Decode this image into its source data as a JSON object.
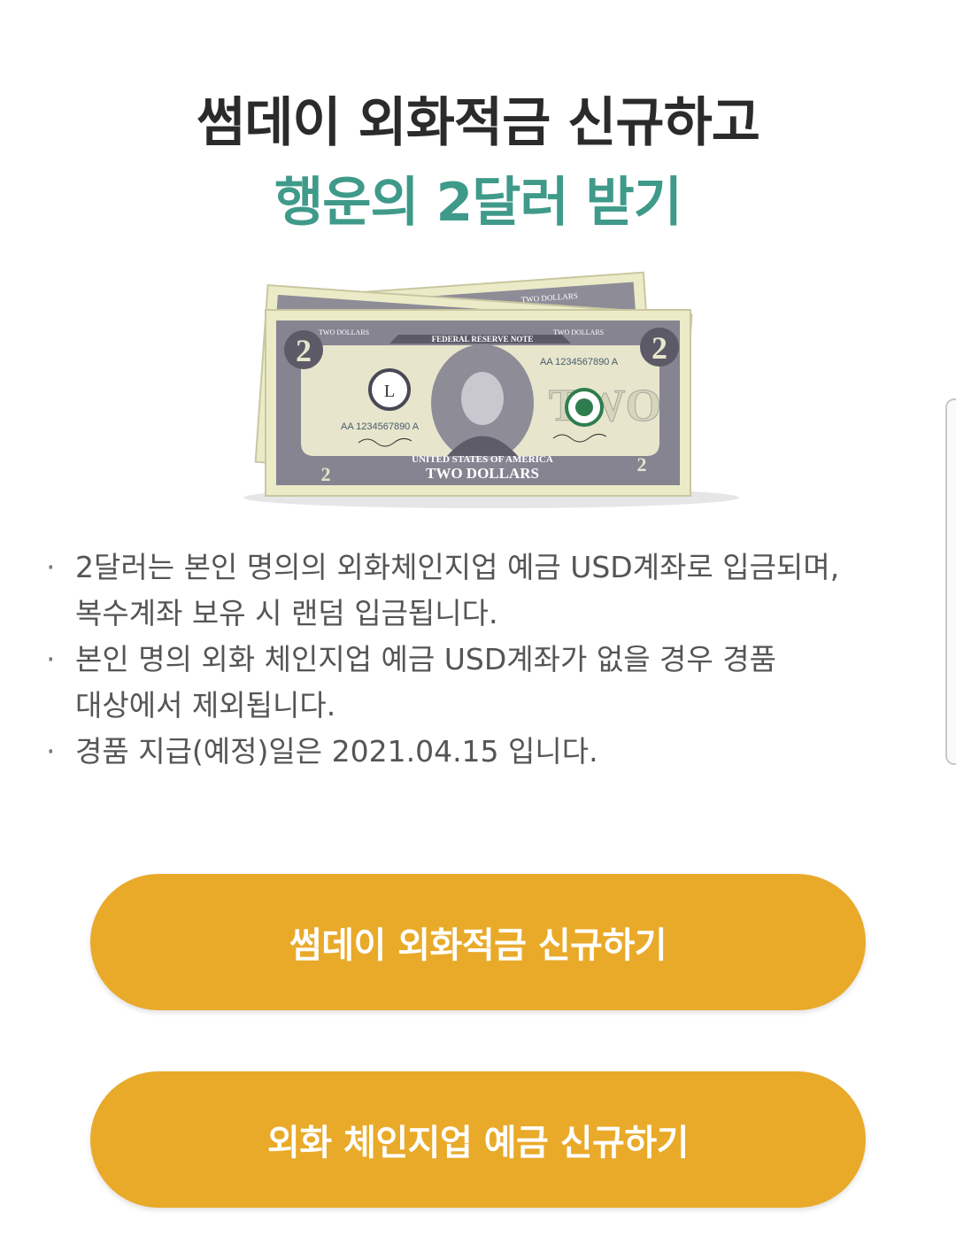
{
  "header": {
    "title_line1": "썸데이 외화적금 신규하고",
    "title_line2": "행운의 2달러 받기",
    "accent_color": "#3f9a8a"
  },
  "illustration": {
    "top_label": "TWO DOLLARS",
    "banner": "FEDERAL RESERVE NOTE",
    "serial_top": "AA 1234567890 A",
    "serial_left": "AA 1234567890 A",
    "seal_letter": "L",
    "country": "UNITED STATES OF AMERICA",
    "bottom_label": "TWO DOLLARS",
    "denomination": "2",
    "word": "TWO"
  },
  "notes": {
    "bullet": "·",
    "items": [
      "2달러는 본인 명의의 외화체인지업 예금 USD계좌로 입금되며,\n복수계좌 보유 시 랜덤 입금됩니다.",
      "본인 명의 외화 체인지업 예금 USD계좌가 없을 경우 경품\n대상에서 제외됩니다.",
      "경품 지급(예정)일은 2021.04.15 입니다."
    ]
  },
  "buttons": {
    "primary_label": "썸데이 외화적금 신규하기",
    "secondary_label": "외화 체인지업 예금 신규하기",
    "button_color": "#e9aa2a"
  }
}
